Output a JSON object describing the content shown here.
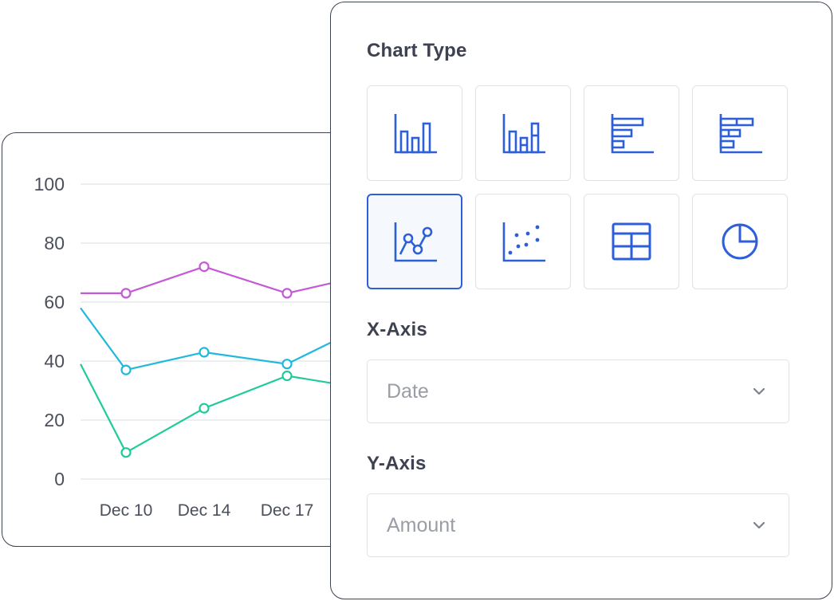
{
  "chart_data": {
    "type": "line",
    "title": "",
    "xlabel": "",
    "ylabel": "",
    "ylim": [
      0,
      100
    ],
    "yticks": [
      0,
      20,
      40,
      60,
      80,
      100
    ],
    "categories": [
      "Dec 10",
      "Dec 14",
      "Dec 17"
    ],
    "x_visible_labels": [
      "Dec 10",
      "Dec 14",
      "Dec 17"
    ],
    "series": [
      {
        "color": "#c45ad6",
        "start": 63,
        "values": [
          63,
          72,
          63
        ],
        "end": 70
      },
      {
        "color": "#20b8dc",
        "start": 58,
        "values": [
          37,
          43,
          39
        ],
        "end": 54
      },
      {
        "color": "#1fcb9a",
        "start": 39,
        "values": [
          9,
          24,
          35
        ],
        "end": 30
      }
    ],
    "grid": true,
    "legend": "none"
  },
  "panel": {
    "chart_type_title": "Chart Type",
    "chart_types": [
      {
        "icon": "bar-chart-icon",
        "selected": false
      },
      {
        "icon": "stacked-bar-chart-icon",
        "selected": false
      },
      {
        "icon": "horizontal-bar-chart-icon",
        "selected": false
      },
      {
        "icon": "stacked-horizontal-bar-chart-icon",
        "selected": false
      },
      {
        "icon": "line-chart-icon",
        "selected": true
      },
      {
        "icon": "scatter-chart-icon",
        "selected": false
      },
      {
        "icon": "table-icon",
        "selected": false
      },
      {
        "icon": "pie-chart-icon",
        "selected": false
      }
    ],
    "x_axis_title": "X-Axis",
    "x_axis_value": "Date",
    "y_axis_title": "Y-Axis",
    "y_axis_value": "Amount",
    "accent_color": "#2d5fd9"
  }
}
